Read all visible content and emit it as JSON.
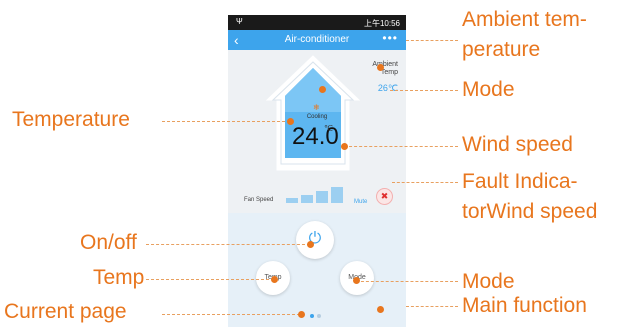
{
  "annotations": {
    "ambient_temperature_line1": "Ambient tem-",
    "ambient_temperature_line2": "perature",
    "mode_top": "Mode",
    "temperature": "Temperature",
    "wind_speed": "Wind speed",
    "fault_line1": "Fault Indica-",
    "fault_line2": "torWind speed",
    "on_off": "On/off",
    "temp": "Temp",
    "mode_bottom": "Mode",
    "current_page": "Current page",
    "main_function": "Main function"
  },
  "phone": {
    "status_time": "上午10:56",
    "app_title": "Air-conditioner",
    "back_icon": "chevron-left-icon",
    "more_icon": "more-dots-icon",
    "ambient_label_line1": "Ambient",
    "ambient_label_line2": "Temp",
    "ambient_value": "26℃",
    "mode_text": "Cooling",
    "temperature_value": "24.0",
    "temperature_unit": "℃",
    "fan_speed_label": "Fan Speed",
    "mute_label": "Mute",
    "temp_button_label": "Temp",
    "mode_button_label": "Mode",
    "current_page_index": 1,
    "page_count": 2
  },
  "colors": {
    "accent_orange": "#e8761e",
    "app_blue": "#3da4ec",
    "fan_bar_blue": "#9ccff1",
    "fault_red": "#e03030"
  }
}
